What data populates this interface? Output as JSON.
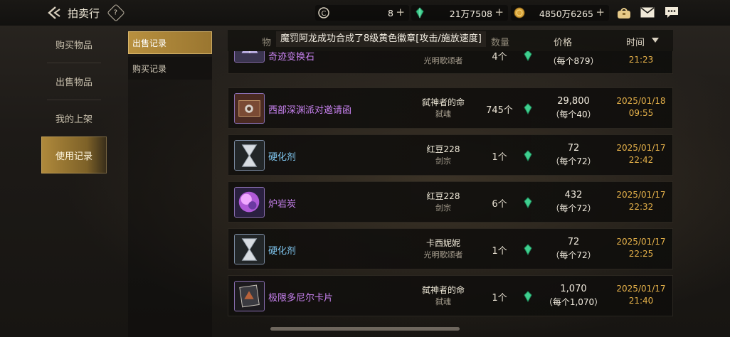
{
  "header": {
    "title": "拍卖行",
    "help": "?",
    "currencies": [
      {
        "icon": "c-coin-icon",
        "value": "8"
      },
      {
        "icon": "green-gem-icon",
        "value": "21万7508"
      },
      {
        "icon": "gold-coin-icon",
        "value": "4850万6265"
      }
    ],
    "plus": "+"
  },
  "leftnav": {
    "items": [
      {
        "label": "购买物品"
      },
      {
        "label": "出售物品"
      },
      {
        "label": "我的上架"
      },
      {
        "label": "使用记录"
      }
    ]
  },
  "subnav": {
    "items": [
      {
        "label": "出售记录"
      },
      {
        "label": "购买记录"
      }
    ]
  },
  "table": {
    "col_item": "物",
    "col_qty": "数量",
    "col_price": "价格",
    "col_time": "时间",
    "notice": "魔罚阿龙成功合成了8级黄色徽章[攻击/施放速度]",
    "rows": [
      {
        "name": "奇迹变换石",
        "name_color": "purple",
        "seller": "",
        "seller_class": "光明歌颂者",
        "qty": "4个",
        "price": "",
        "unit_price": "（每个879）",
        "date": "",
        "time": "21:23"
      },
      {
        "name": "西部深渊派对邀请函",
        "name_color": "purple",
        "seller": "弑神者的命",
        "seller_class": "弑魂",
        "qty": "745个",
        "price": "29,800",
        "unit_price": "（每个40）",
        "date": "2025/01/18",
        "time": "09:55"
      },
      {
        "name": "硬化剂",
        "name_color": "blue",
        "seller": "红豆228",
        "seller_class": "剑宗",
        "qty": "1个",
        "price": "72",
        "unit_price": "（每个72）",
        "date": "2025/01/17",
        "time": "22:42"
      },
      {
        "name": "炉岩炭",
        "name_color": "purple",
        "seller": "红豆228",
        "seller_class": "剑宗",
        "qty": "6个",
        "price": "432",
        "unit_price": "（每个72）",
        "date": "2025/01/17",
        "time": "22:32"
      },
      {
        "name": "硬化剂",
        "name_color": "blue",
        "seller": "卡西妮妮",
        "seller_class": "光明歌颂者",
        "qty": "1个",
        "price": "72",
        "unit_price": "（每个72）",
        "date": "2025/01/17",
        "time": "22:25"
      },
      {
        "name": "极限多尼尔卡片",
        "name_color": "purple",
        "seller": "弑神者的命",
        "seller_class": "弑魂",
        "qty": "1个",
        "price": "1,070",
        "unit_price": "（每个1,070）",
        "date": "2025/01/17",
        "time": "21:40"
      }
    ]
  }
}
